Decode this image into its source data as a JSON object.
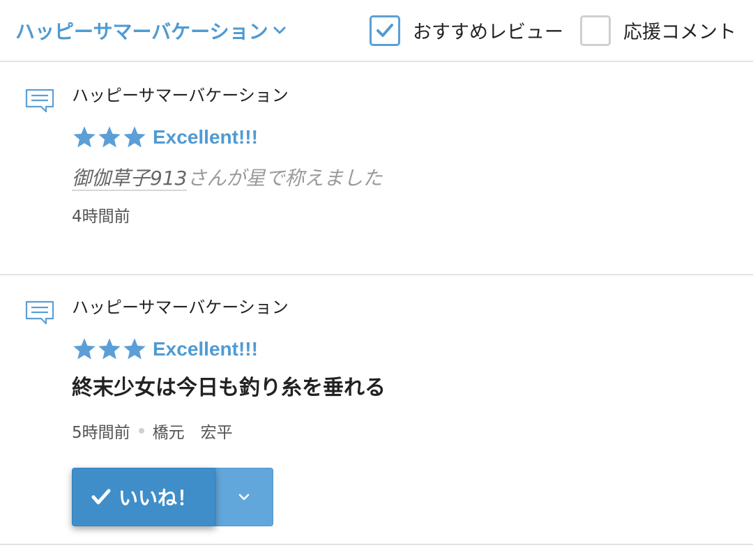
{
  "header": {
    "series_select": "ハッピーサマーバケーション",
    "filters": [
      {
        "label": "おすすめレビュー",
        "checked": true
      },
      {
        "label": "応援コメント",
        "checked": false
      }
    ]
  },
  "feed": [
    {
      "series_title": "ハッピーサマーバケーション",
      "stars": 3,
      "rating_label": "Excellent!!!",
      "activity_user": "御伽草子913",
      "activity_text": "さんが星で称えました",
      "time": "4時間前"
    },
    {
      "series_title": "ハッピーサマーバケーション",
      "stars": 3,
      "rating_label": "Excellent!!!",
      "book_title": "終末少女は今日も釣り糸を垂れる",
      "time": "5時間前",
      "author": "橋元　宏平",
      "like_label": "いいね！"
    }
  ],
  "colors": {
    "accent": "#4f9bd3",
    "like_button": "#3f8ec9",
    "like_dropdown": "#62a7dc",
    "divider": "#e3e3e3"
  },
  "icons": [
    "chevron-down-icon",
    "check-icon",
    "comment-icon",
    "star-icon"
  ]
}
